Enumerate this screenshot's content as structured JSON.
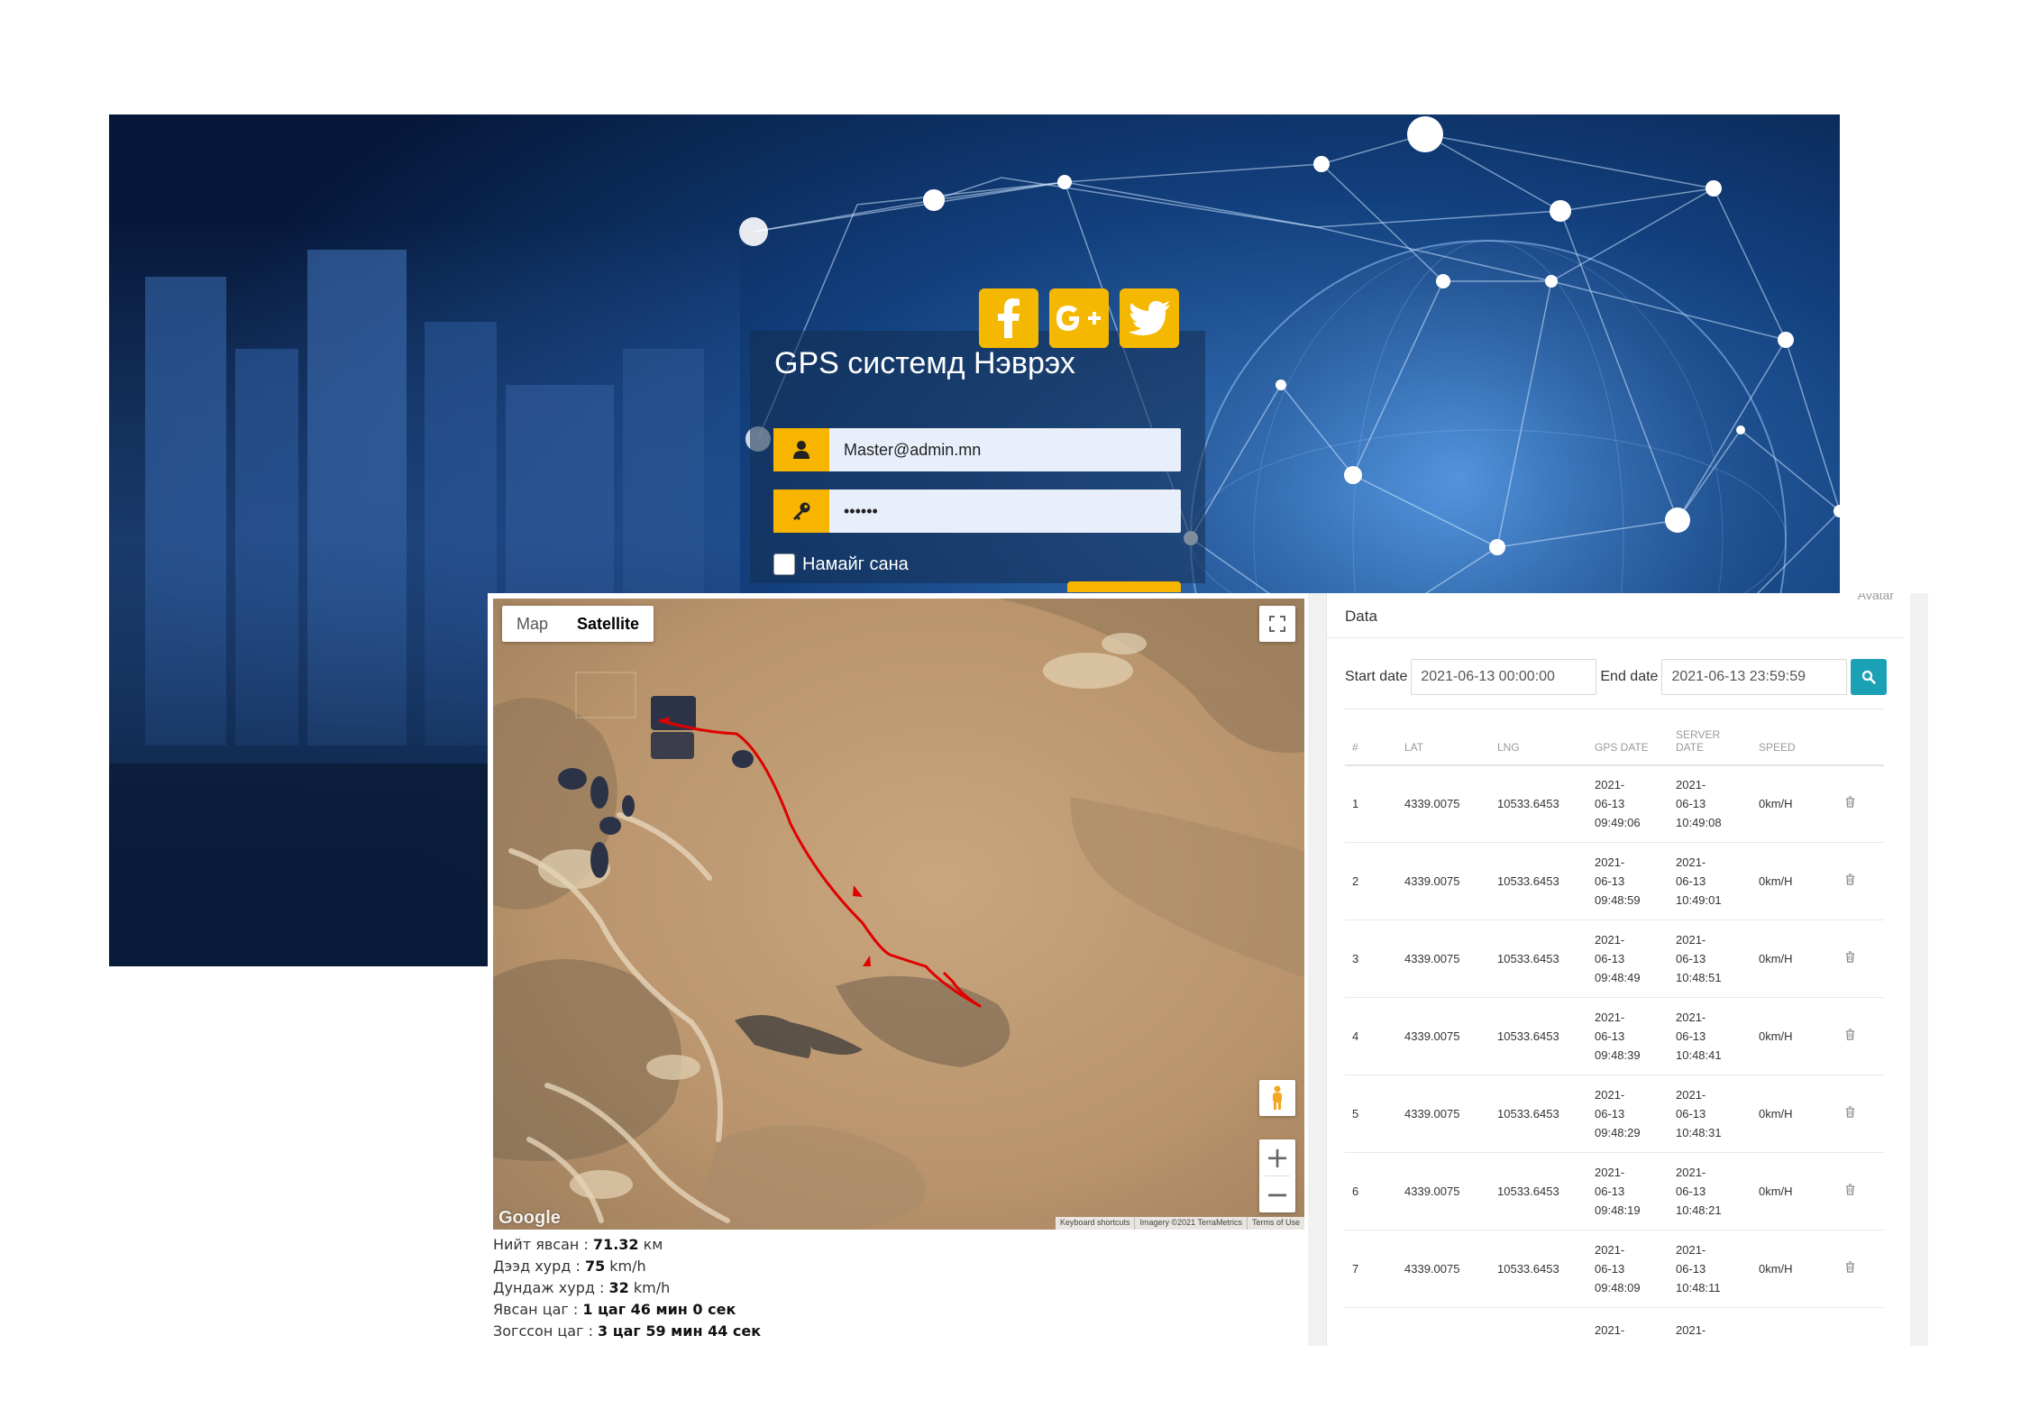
{
  "login": {
    "title": "GPS системд Нэврэх",
    "email_value": "Master@admin.mn",
    "password_value": "••••••",
    "remember_label": "Намайг сана",
    "social": [
      "facebook-icon",
      "google-plus-icon",
      "twitter-icon"
    ]
  },
  "map": {
    "type_options": [
      "Map",
      "Satellite"
    ],
    "active_type": "Satellite",
    "google_logo": "Google",
    "attribution": [
      "Keyboard shortcuts",
      "Imagery ©2021 TerraMetrics",
      "Terms of Use"
    ],
    "zoom_in": "+",
    "zoom_out": "−",
    "route_color": "#e00000"
  },
  "stats": [
    {
      "label": "Нийт явсан : ",
      "value": "71.32",
      "unit": " км"
    },
    {
      "label": "Дээд хурд : ",
      "value": "75",
      "unit": " km/h"
    },
    {
      "label": "Дундаж хурд : ",
      "value": "32",
      "unit": " km/h"
    },
    {
      "label": "Явсан цаг : ",
      "value": "1 цаг 46 мин 0 сек",
      "unit": ""
    },
    {
      "label": "Зогссон цаг : ",
      "value": "3 цаг 59 мин 44 сек",
      "unit": ""
    }
  ],
  "data_panel": {
    "avatar_label": "Avatar",
    "title": "Data",
    "start_label": "Start date",
    "start_value": "2021-06-13 00:00:00",
    "end_label": "End date",
    "end_value": "2021-06-13 23:59:59",
    "headers": [
      "#",
      "LAT",
      "LNG",
      "GPS DATE",
      "SERVER DATE",
      "SPEED",
      ""
    ],
    "rows": [
      {
        "idx": "1",
        "lat": "4339.0075",
        "lng": "10533.6453",
        "gps": [
          "2021-",
          "06-13",
          "09:49:06"
        ],
        "srv": [
          "2021-",
          "06-13",
          "10:49:08"
        ],
        "speed": "0km/H"
      },
      {
        "idx": "2",
        "lat": "4339.0075",
        "lng": "10533.6453",
        "gps": [
          "2021-",
          "06-13",
          "09:48:59"
        ],
        "srv": [
          "2021-",
          "06-13",
          "10:49:01"
        ],
        "speed": "0km/H"
      },
      {
        "idx": "3",
        "lat": "4339.0075",
        "lng": "10533.6453",
        "gps": [
          "2021-",
          "06-13",
          "09:48:49"
        ],
        "srv": [
          "2021-",
          "06-13",
          "10:48:51"
        ],
        "speed": "0km/H"
      },
      {
        "idx": "4",
        "lat": "4339.0075",
        "lng": "10533.6453",
        "gps": [
          "2021-",
          "06-13",
          "09:48:39"
        ],
        "srv": [
          "2021-",
          "06-13",
          "10:48:41"
        ],
        "speed": "0km/H"
      },
      {
        "idx": "5",
        "lat": "4339.0075",
        "lng": "10533.6453",
        "gps": [
          "2021-",
          "06-13",
          "09:48:29"
        ],
        "srv": [
          "2021-",
          "06-13",
          "10:48:31"
        ],
        "speed": "0km/H"
      },
      {
        "idx": "6",
        "lat": "4339.0075",
        "lng": "10533.6453",
        "gps": [
          "2021-",
          "06-13",
          "09:48:19"
        ],
        "srv": [
          "2021-",
          "06-13",
          "10:48:21"
        ],
        "speed": "0km/H"
      },
      {
        "idx": "7",
        "lat": "4339.0075",
        "lng": "10533.6453",
        "gps": [
          "2021-",
          "06-13",
          "09:48:09"
        ],
        "srv": [
          "2021-",
          "06-13",
          "10:48:11"
        ],
        "speed": "0km/H"
      },
      {
        "idx": "",
        "lat": "",
        "lng": "",
        "gps": [
          "2021-"
        ],
        "srv": [
          "2021-"
        ],
        "speed": ""
      }
    ]
  },
  "colors": {
    "accent_yellow": "#f7b500",
    "search_teal": "#1ba1b5",
    "login_bg_dark": "#0c2a55"
  }
}
